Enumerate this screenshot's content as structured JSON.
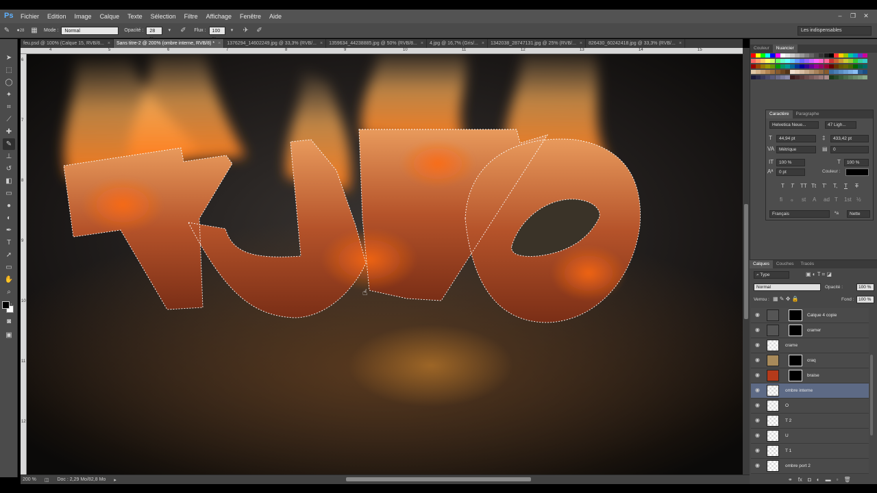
{
  "app": {
    "logo": "Ps",
    "menu": [
      "Fichier",
      "Edition",
      "Image",
      "Calque",
      "Texte",
      "Sélection",
      "Filtre",
      "Affichage",
      "Fenêtre",
      "Aide"
    ],
    "window_controls": [
      "–",
      "❐",
      "✕"
    ]
  },
  "options_bar": {
    "brush_size": "28",
    "mode_label": "Mode :",
    "mode_value": "Normal",
    "opacity_label": "Opacité :",
    "opacity_value": "28 %",
    "flow_label": "Flux :",
    "flow_value": "100 %",
    "workspace": "Les indispensables"
  },
  "tabs": [
    {
      "label": "feu.psd @ 100% (Calque 15, RVB/8...",
      "active": false
    },
    {
      "label": "Sans titre-2 @ 200% (ombre interne, RVB/8) *",
      "active": true
    },
    {
      "label": "1376294_14602249.jpg @ 33,3% (RVB/...",
      "active": false
    },
    {
      "label": "1359634_44238885.jpg @ 50% (RVB/8...",
      "active": false
    },
    {
      "label": "4.jpg @ 16,7% (Gris/...",
      "active": false
    },
    {
      "label": "1342038_28747131.jpg @ 25% (RVB/...",
      "active": false
    },
    {
      "label": "826430_60242418.jpg @ 33,3% (RVB/...",
      "active": false
    }
  ],
  "ruler_h": [
    "4",
    "5",
    "6",
    "7",
    "8",
    "9",
    "10",
    "11",
    "12",
    "13",
    "14",
    "15"
  ],
  "ruler_v": [
    "6",
    "7",
    "8",
    "9",
    "10",
    "11",
    "12"
  ],
  "status": {
    "zoom": "200 %",
    "doc": "Doc : 2,29 Mo/82,8 Mo"
  },
  "color_panel": {
    "tabs": [
      "Couleur",
      "Nuancier"
    ],
    "active_tab": "Nuancier"
  },
  "character_panel": {
    "tabs": [
      "Caractère",
      "Paragraphe"
    ],
    "font_family": "Helvetica Neue...",
    "font_style": "47 Ligh...",
    "font_size": "44,94 pt",
    "leading": "433,42 pt",
    "kerning": "Métrique",
    "tracking": "0",
    "vscale": "100 %",
    "hscale": "100 %",
    "baseline": "0 pt",
    "color_label": "Couleur :",
    "language": "Français",
    "aa_label": "ªa",
    "antialias": "Nette",
    "type_buttons": [
      "T",
      "T",
      "TT",
      "Tt",
      "T'",
      "T,",
      "T",
      "T"
    ],
    "ot_buttons": [
      "fi",
      "ℴ",
      "st",
      "A",
      "ad",
      "T",
      "1st",
      "½"
    ]
  },
  "layers_panel": {
    "tabs": [
      "Calques",
      "Couches",
      "Tracés"
    ],
    "filter": "Type",
    "blend": "Normal",
    "opacity_label": "Opacité :",
    "opacity_value": "100 %",
    "lock_label": "Verrou :",
    "fill_label": "Fond :",
    "fill_value": "100 %",
    "layers": [
      {
        "name": "Calque 4 copie",
        "mask": true,
        "selected": false
      },
      {
        "name": "cramer",
        "mask": true,
        "selected": false
      },
      {
        "name": "crame",
        "mask": false,
        "selected": false
      },
      {
        "name": "craq",
        "mask": true,
        "selected": false
      },
      {
        "name": "braise",
        "mask": true,
        "selected": false
      },
      {
        "name": "ombre interne",
        "mask": false,
        "selected": true
      },
      {
        "name": "O",
        "mask": false,
        "selected": false
      },
      {
        "name": "T 2",
        "mask": false,
        "selected": false
      },
      {
        "name": "U",
        "mask": false,
        "selected": false
      },
      {
        "name": "T 1",
        "mask": false,
        "selected": false
      },
      {
        "name": "ombre port 2",
        "mask": false,
        "selected": false
      }
    ]
  },
  "colors": {
    "ps_blue": "#5fb2ff",
    "selected_layer": "#5d6a85",
    "panel_bg": "#4a4a4a"
  }
}
